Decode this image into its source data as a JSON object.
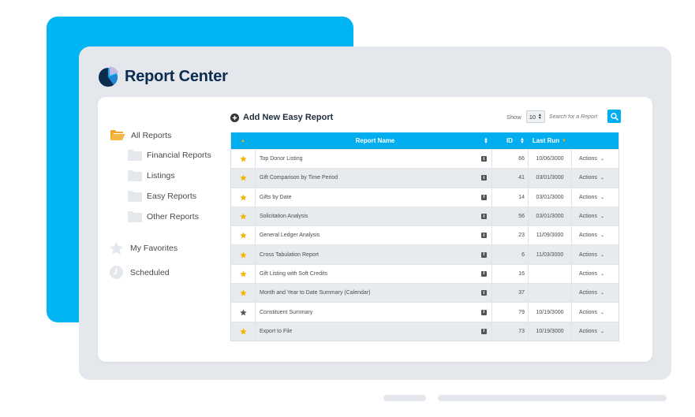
{
  "app": {
    "title": "Report Center"
  },
  "sidebar": {
    "all_reports": "All Reports",
    "folders": [
      "Financial Reports",
      "Listings",
      "Easy Reports",
      "Other Reports"
    ],
    "favorites": "My Favorites",
    "scheduled": "Scheduled"
  },
  "toolbar": {
    "add_label": "Add New Easy Report",
    "show_label": "Show",
    "show_value": "10",
    "search_placeholder": "Search for a Report"
  },
  "table": {
    "headers": {
      "name": "Report Name",
      "id": "ID",
      "last_run": "Last Run"
    },
    "action_label": "Actions",
    "rows": [
      {
        "name": "Top Donor Listing",
        "id": "66",
        "last_run": "10/06/3000",
        "favorite": true
      },
      {
        "name": "Gift Comparison by Time Period",
        "id": "41",
        "last_run": "03/01/3000",
        "favorite": true
      },
      {
        "name": "Gifts by Date",
        "id": "14",
        "last_run": "03/01/3000",
        "favorite": true
      },
      {
        "name": "Solicitation Analysis",
        "id": "56",
        "last_run": "03/01/3000",
        "favorite": true
      },
      {
        "name": "General Ledger Analysis",
        "id": "23",
        "last_run": "11/09/3000",
        "favorite": true
      },
      {
        "name": "Cross Tabulation Report",
        "id": "6",
        "last_run": "11/03/3000",
        "favorite": true
      },
      {
        "name": "Gift Listing with Soft Credits",
        "id": "16",
        "last_run": "",
        "favorite": true
      },
      {
        "name": "Month and Year to Date Summary (Calendar)",
        "id": "37",
        "last_run": "",
        "favorite": true
      },
      {
        "name": "Constituent Summary",
        "id": "79",
        "last_run": "10/19/3000",
        "favorite": false
      },
      {
        "name": "Export to File",
        "id": "73",
        "last_run": "10/19/3000",
        "favorite": true
      }
    ]
  },
  "colors": {
    "accent": "#00aeef",
    "star_active": "#f5b400",
    "star_inactive": "#555555",
    "brand_text": "#0b2b4f"
  }
}
